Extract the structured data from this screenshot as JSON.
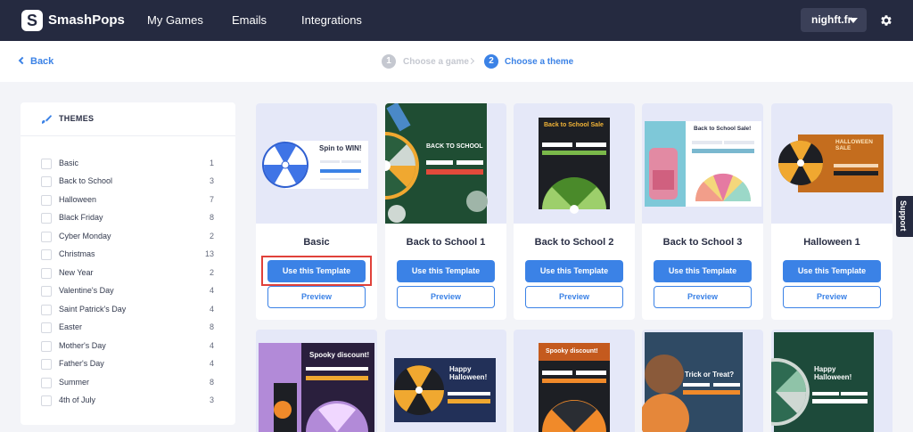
{
  "app": {
    "logo_letter": "S",
    "brand": "SmashPops",
    "nav": [
      "My Games",
      "Emails",
      "Integrations"
    ],
    "account": "nighft.fr",
    "gear_icon": "gear-icon"
  },
  "subnav": {
    "back_label": "Back",
    "steps": [
      {
        "num": "1",
        "label": "Choose a game",
        "active": false
      },
      {
        "num": "2",
        "label": "Choose a theme",
        "active": true
      }
    ]
  },
  "sidebar": {
    "title": "THEMES",
    "themes": [
      {
        "label": "Basic",
        "count": "1"
      },
      {
        "label": "Back to School",
        "count": "3"
      },
      {
        "label": "Halloween",
        "count": "7"
      },
      {
        "label": "Black Friday",
        "count": "8"
      },
      {
        "label": "Cyber Monday",
        "count": "2"
      },
      {
        "label": "Christmas",
        "count": "13"
      },
      {
        "label": "New Year",
        "count": "2"
      },
      {
        "label": "Valentine's Day",
        "count": "4"
      },
      {
        "label": "Saint Patrick's Day",
        "count": "4"
      },
      {
        "label": "Easter",
        "count": "8"
      },
      {
        "label": "Mother's Day",
        "count": "4"
      },
      {
        "label": "Father's Day",
        "count": "4"
      },
      {
        "label": "Summer",
        "count": "8"
      },
      {
        "label": "4th of July",
        "count": "3"
      }
    ]
  },
  "templates": {
    "use_label": "Use this Template",
    "preview_label": "Preview",
    "cards": [
      {
        "name": "Basic",
        "thumb_title": "Spin to WIN!"
      },
      {
        "name": "Back to School 1",
        "thumb_title": "BACK TO SCHOOL"
      },
      {
        "name": "Back to School 2",
        "thumb_title": "Back to School Sale"
      },
      {
        "name": "Back to School 3",
        "thumb_title": "Back to School Sale!"
      },
      {
        "name": "Halloween 1",
        "thumb_title": "HALLOWEEN SALE"
      }
    ],
    "row2": [
      {
        "thumb_title": "Spooky discount!"
      },
      {
        "thumb_title": "Happy Halloween!"
      },
      {
        "thumb_title": "Spooky discount!"
      },
      {
        "thumb_title": "Trick or Treat?"
      },
      {
        "thumb_title": "Happy Halloween!"
      }
    ]
  },
  "support_label": "Support",
  "colors": {
    "accent": "#3b82e6",
    "topbar": "#252a40",
    "highlight": "#e0413a"
  }
}
